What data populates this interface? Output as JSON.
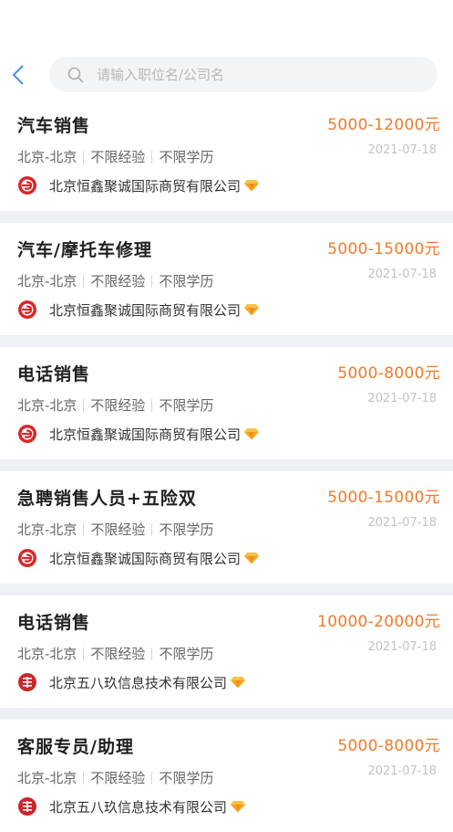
{
  "search": {
    "placeholder": "请输入职位名/公司名"
  },
  "jobs": [
    {
      "title": "汽车销售",
      "salary": "5000-12000元",
      "loc": "北京-北京",
      "exp": "不限经验",
      "edu": "不限学历",
      "date": "2021-07-18",
      "company": "北京恒鑫聚诚国际商贸有限公司",
      "logo": "hengxin-logo"
    },
    {
      "title": "汽车/摩托车修理",
      "salary": "5000-15000元",
      "loc": "北京-北京",
      "exp": "不限经验",
      "edu": "不限学历",
      "date": "2021-07-18",
      "company": "北京恒鑫聚诚国际商贸有限公司",
      "logo": "hengxin-logo"
    },
    {
      "title": "电话销售",
      "salary": "5000-8000元",
      "loc": "北京-北京",
      "exp": "不限经验",
      "edu": "不限学历",
      "date": "2021-07-18",
      "company": "北京恒鑫聚诚国际商贸有限公司",
      "logo": "hengxin-logo"
    },
    {
      "title": "急聘销售人员+五险双",
      "salary": "5000-15000元",
      "loc": "北京-北京",
      "exp": "不限经验",
      "edu": "不限学历",
      "date": "2021-07-18",
      "company": "北京恒鑫聚诚国际商贸有限公司",
      "logo": "hengxin-logo"
    },
    {
      "title": "电话销售",
      "salary": "10000-20000元",
      "loc": "北京-北京",
      "exp": "不限经验",
      "edu": "不限学历",
      "date": "2021-07-18",
      "company": "北京五八玖信息技术有限公司",
      "logo": "wubajiu-logo"
    },
    {
      "title": "客服专员/助理",
      "salary": "5000-8000元",
      "loc": "北京-北京",
      "exp": "不限经验",
      "edu": "不限学历",
      "date": "2021-07-18",
      "company": "北京五八玖信息技术有限公司",
      "logo": "wubajiu-logo"
    }
  ],
  "colors": {
    "salary": "#f07a2a",
    "accent": "#4a90e2",
    "logo_red": "#d9262b",
    "separator": "#eff0f3"
  }
}
